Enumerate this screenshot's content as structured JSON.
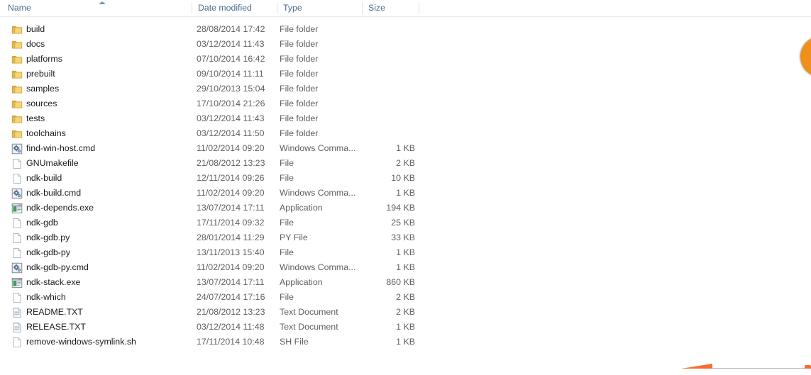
{
  "window": {
    "kind": "windows-explorer-file-list"
  },
  "columns": {
    "name": "Name",
    "date_modified": "Date modified",
    "type": "Type",
    "size": "Size",
    "sorted_by": "Name",
    "sort_direction": "ascending"
  },
  "colors": {
    "header_text": "#4a6c8f",
    "row_name_text": "#1b1b1b",
    "row_meta_text": "#606060",
    "divider": "#dce4ec",
    "folder_icon": "#f2c14a",
    "accent_orange": "#ef8f1c",
    "accent_orange_wedge": "#f96a33"
  },
  "files": [
    {
      "name": "build",
      "date": "28/08/2014 17:42",
      "type": "File folder",
      "size": "",
      "icon": "folder-icon"
    },
    {
      "name": "docs",
      "date": "03/12/2014 11:43",
      "type": "File folder",
      "size": "",
      "icon": "folder-icon"
    },
    {
      "name": "platforms",
      "date": "07/10/2014 16:42",
      "type": "File folder",
      "size": "",
      "icon": "folder-icon"
    },
    {
      "name": "prebuilt",
      "date": "09/10/2014 11:11",
      "type": "File folder",
      "size": "",
      "icon": "folder-icon"
    },
    {
      "name": "samples",
      "date": "29/10/2013 15:04",
      "type": "File folder",
      "size": "",
      "icon": "folder-icon"
    },
    {
      "name": "sources",
      "date": "17/10/2014 21:26",
      "type": "File folder",
      "size": "",
      "icon": "folder-icon"
    },
    {
      "name": "tests",
      "date": "03/12/2014 11:43",
      "type": "File folder",
      "size": "",
      "icon": "folder-icon"
    },
    {
      "name": "toolchains",
      "date": "03/12/2014 11:50",
      "type": "File folder",
      "size": "",
      "icon": "folder-icon"
    },
    {
      "name": "find-win-host.cmd",
      "date": "11/02/2014 09:20",
      "type": "Windows Comma...",
      "size": "1 KB",
      "icon": "command-script-icon"
    },
    {
      "name": "GNUmakefile",
      "date": "21/08/2012 13:23",
      "type": "File",
      "size": "2 KB",
      "icon": "blank-file-icon"
    },
    {
      "name": "ndk-build",
      "date": "12/11/2014 09:26",
      "type": "File",
      "size": "10 KB",
      "icon": "blank-file-icon"
    },
    {
      "name": "ndk-build.cmd",
      "date": "11/02/2014 09:20",
      "type": "Windows Comma...",
      "size": "1 KB",
      "icon": "command-script-icon"
    },
    {
      "name": "ndk-depends.exe",
      "date": "13/07/2014 17:11",
      "type": "Application",
      "size": "194 KB",
      "icon": "application-icon"
    },
    {
      "name": "ndk-gdb",
      "date": "17/11/2014 09:32",
      "type": "File",
      "size": "25 KB",
      "icon": "blank-file-icon"
    },
    {
      "name": "ndk-gdb.py",
      "date": "28/01/2014 11:29",
      "type": "PY File",
      "size": "33 KB",
      "icon": "blank-file-icon"
    },
    {
      "name": "ndk-gdb-py",
      "date": "13/11/2013 15:40",
      "type": "File",
      "size": "1 KB",
      "icon": "blank-file-icon"
    },
    {
      "name": "ndk-gdb-py.cmd",
      "date": "11/02/2014 09:20",
      "type": "Windows Comma...",
      "size": "1 KB",
      "icon": "command-script-icon"
    },
    {
      "name": "ndk-stack.exe",
      "date": "13/07/2014 17:11",
      "type": "Application",
      "size": "860 KB",
      "icon": "application-icon"
    },
    {
      "name": "ndk-which",
      "date": "24/07/2014 17:16",
      "type": "File",
      "size": "2 KB",
      "icon": "blank-file-icon"
    },
    {
      "name": "README.TXT",
      "date": "21/08/2012 13:23",
      "type": "Text Document",
      "size": "2 KB",
      "icon": "text-document-icon"
    },
    {
      "name": "RELEASE.TXT",
      "date": "03/12/2014 11:48",
      "type": "Text Document",
      "size": "1 KB",
      "icon": "text-document-icon"
    },
    {
      "name": "remove-windows-symlink.sh",
      "date": "17/11/2014 10:48",
      "type": "SH File",
      "size": "1 KB",
      "icon": "blank-file-icon"
    }
  ]
}
